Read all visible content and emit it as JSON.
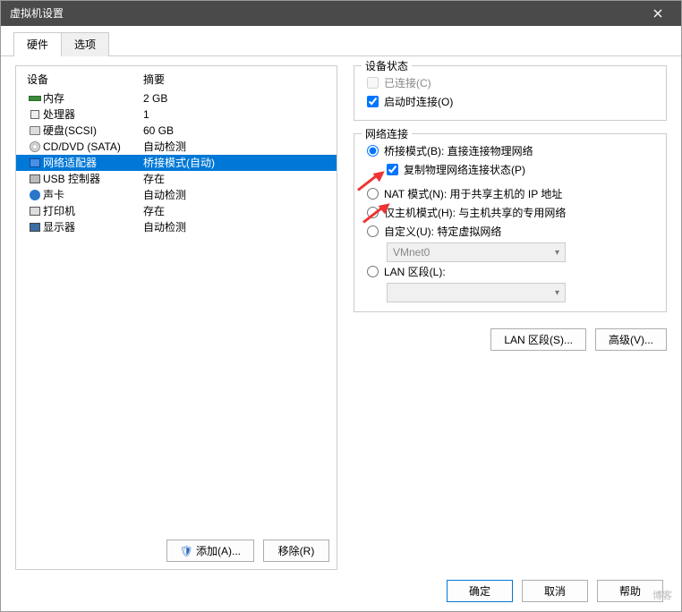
{
  "window": {
    "title": "虚拟机设置"
  },
  "tabs": {
    "hardware": "硬件",
    "options": "选项"
  },
  "hw_table": {
    "header_device": "设备",
    "header_summary": "摘要",
    "rows": [
      {
        "icon": "memory-icon",
        "device": "内存",
        "summary": "2 GB"
      },
      {
        "icon": "cpu-icon",
        "device": "处理器",
        "summary": "1"
      },
      {
        "icon": "hdd-icon",
        "device": "硬盘(SCSI)",
        "summary": "60 GB"
      },
      {
        "icon": "cd-icon",
        "device": "CD/DVD (SATA)",
        "summary": "自动检测"
      },
      {
        "icon": "network-icon",
        "device": "网络适配器",
        "summary": "桥接模式(自动)"
      },
      {
        "icon": "usb-icon",
        "device": "USB 控制器",
        "summary": "存在"
      },
      {
        "icon": "sound-icon",
        "device": "声卡",
        "summary": "自动检测"
      },
      {
        "icon": "printer-icon",
        "device": "打印机",
        "summary": "存在"
      },
      {
        "icon": "display-icon",
        "device": "显示器",
        "summary": "自动检测"
      }
    ]
  },
  "left_buttons": {
    "add": "添加(A)...",
    "remove": "移除(R)"
  },
  "device_status": {
    "legend": "设备状态",
    "connected": "已连接(C)",
    "connect_at_power_on": "启动时连接(O)"
  },
  "net_conn": {
    "legend": "网络连接",
    "bridged": "桥接模式(B): 直接连接物理网络",
    "replicate": "复制物理网络连接状态(P)",
    "nat": "NAT 模式(N): 用于共享主机的 IP 地址",
    "hostonly": "仅主机模式(H): 与主机共享的专用网络",
    "custom": "自定义(U): 特定虚拟网络",
    "custom_value": "VMnet0",
    "lan": "LAN 区段(L):",
    "lan_value": ""
  },
  "right_buttons": {
    "lan_segments": "LAN 区段(S)...",
    "advanced": "高级(V)..."
  },
  "footer": {
    "ok": "确定",
    "cancel": "取消",
    "help": "帮助"
  },
  "watermark": "博客"
}
